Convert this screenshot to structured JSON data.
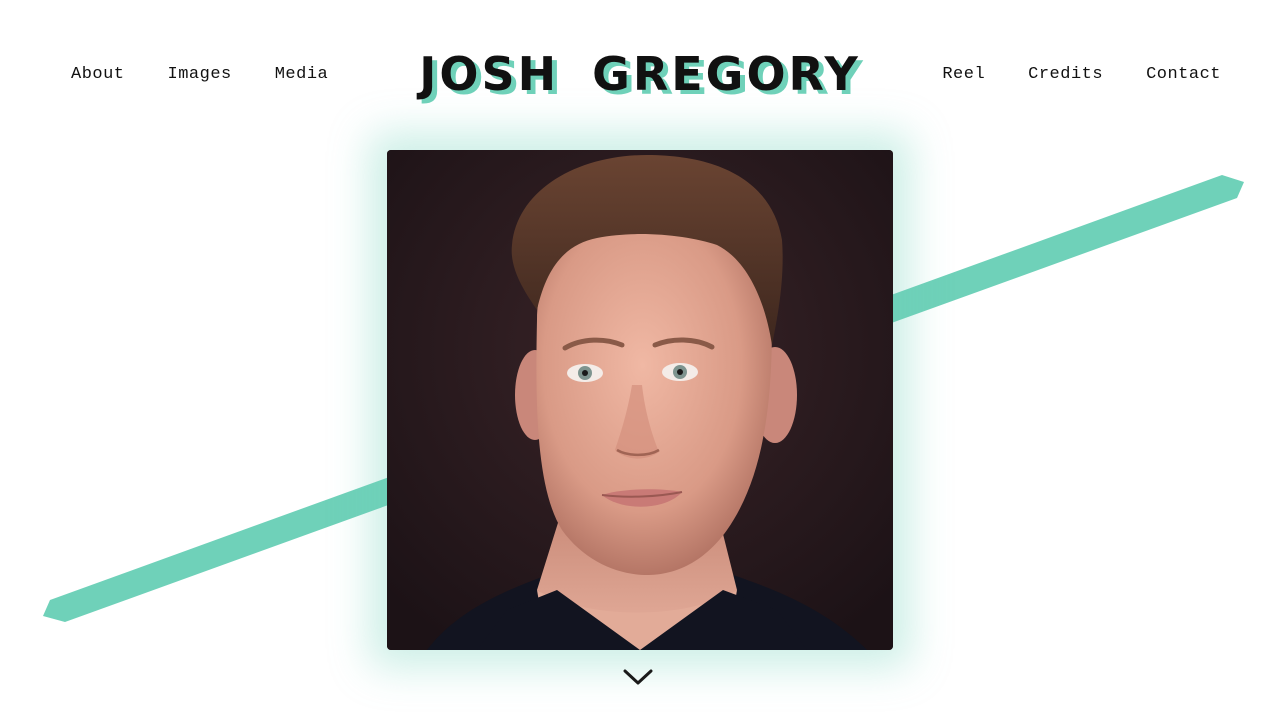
{
  "site": {
    "title": "JOSH GREGORY"
  },
  "nav": {
    "left": [
      {
        "label": "About"
      },
      {
        "label": "Images"
      },
      {
        "label": "Media"
      }
    ],
    "right": [
      {
        "label": "Reel"
      },
      {
        "label": "Credits"
      },
      {
        "label": "Contact"
      }
    ]
  },
  "hero": {
    "image": "headshot-portrait",
    "scroll_icon": "chevron-down-icon"
  },
  "colors": {
    "accent": "#6fd1b9",
    "text": "#111111",
    "background": "#ffffff"
  }
}
